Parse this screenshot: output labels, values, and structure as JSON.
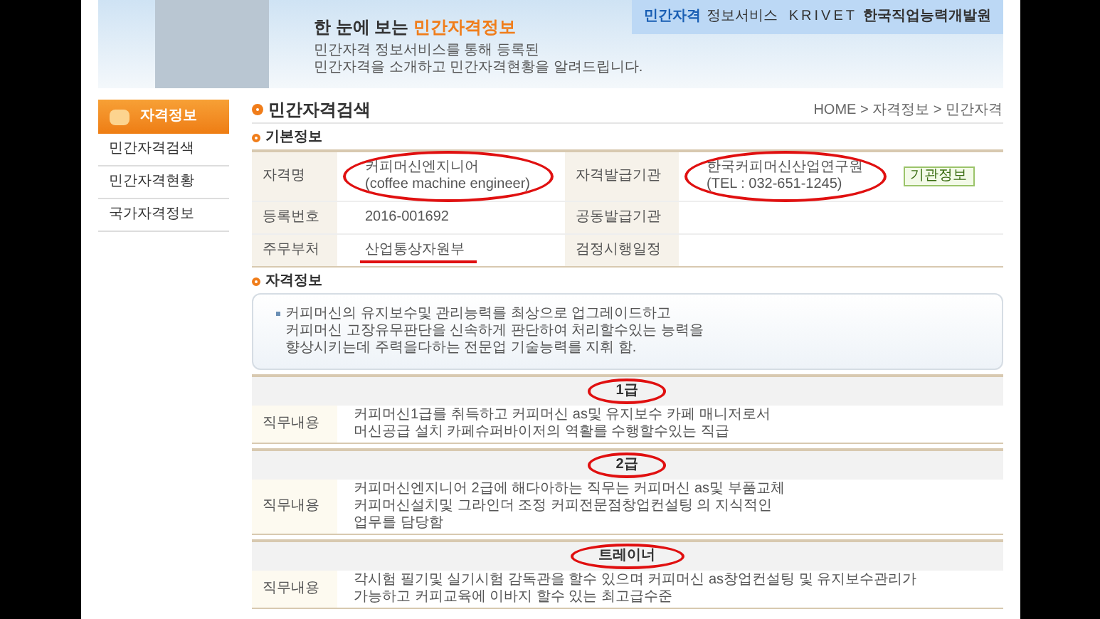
{
  "banner": {
    "headline_prefix": "한 눈에 보는 ",
    "headline_highlight": "민간자격정보",
    "description": [
      "민간자격 정보서비스를 통해 등록된",
      "민간자격을 소개하고 민간자격현황을 알려드립니다."
    ],
    "logo": {
      "service": "민간자격",
      "service_rest": "정보서비스",
      "brand": "KRIVET",
      "org": "한국직업능력개발원"
    }
  },
  "sidebar": {
    "title": "자격정보",
    "items": [
      {
        "label": "민간자격검색"
      },
      {
        "label": "민간자격현황"
      },
      {
        "label": "국가자격정보"
      }
    ]
  },
  "page_title": "민간자격검색",
  "breadcrumb": "HOME > 자격정보 > 민간자격",
  "basic_info": {
    "heading": "기본정보",
    "rows": [
      {
        "label": "자격명",
        "value": [
          "커피머신엔지니어",
          "(coffee machine engineer)"
        ],
        "circled": true,
        "underlined": false,
        "label2": "자격발급기관",
        "value2": [
          "한국커피머신산업연구원",
          "(TEL : 032-651-1245)"
        ],
        "circled2": true,
        "button": "기관정보"
      },
      {
        "label": "등록번호",
        "value": [
          "2016-001692"
        ],
        "circled": false,
        "underlined": false,
        "label2": "공동발급기관",
        "value2": [],
        "circled2": false
      },
      {
        "label": "주무부처",
        "value": [
          "산업통상자원부"
        ],
        "circled": false,
        "underlined": true,
        "label2": "검정시행일정",
        "value2": [],
        "circled2": false
      }
    ]
  },
  "qual_info": {
    "heading": "자격정보",
    "description": [
      "커피머신의 유지보수및 관리능력를 최상으로 업그레이드하고",
      "커피머신 고장유무판단을 신속하게 판단하여 처리할수있는 능력을",
      "향상시키는데 주력을다하는 전문업 기술능력를 지휘 함."
    ]
  },
  "grades": [
    {
      "title": "1급",
      "circled": true,
      "label": "직무내용",
      "lines": [
        "커피머신1급를 취득하고 커피머신 as및 유지보수 카페 매니저로서",
        "머신공급 설치 카페슈퍼바이저의 역활를 수행할수있는 직급"
      ]
    },
    {
      "title": "2급",
      "circled": true,
      "label": "직무내용",
      "lines": [
        "커피머신엔지니어 2급에 해다아하는 직무는 커피머신 as및 부품교체",
        "커피머신설치및 그라인더 조정 커피전문점창업컨설팅 의 지식적인",
        "업무를 담당함"
      ]
    },
    {
      "title": "트레이너",
      "circled": true,
      "label": "직무내용",
      "lines": [
        "각시험 필기및 실기시험 감독관을 할수 있으며 커피머신 as창업컨설팅 및 유지보수관리가",
        "가능하고 커피교육에 이바지 할수 있는 최고급수준"
      ]
    }
  ]
}
